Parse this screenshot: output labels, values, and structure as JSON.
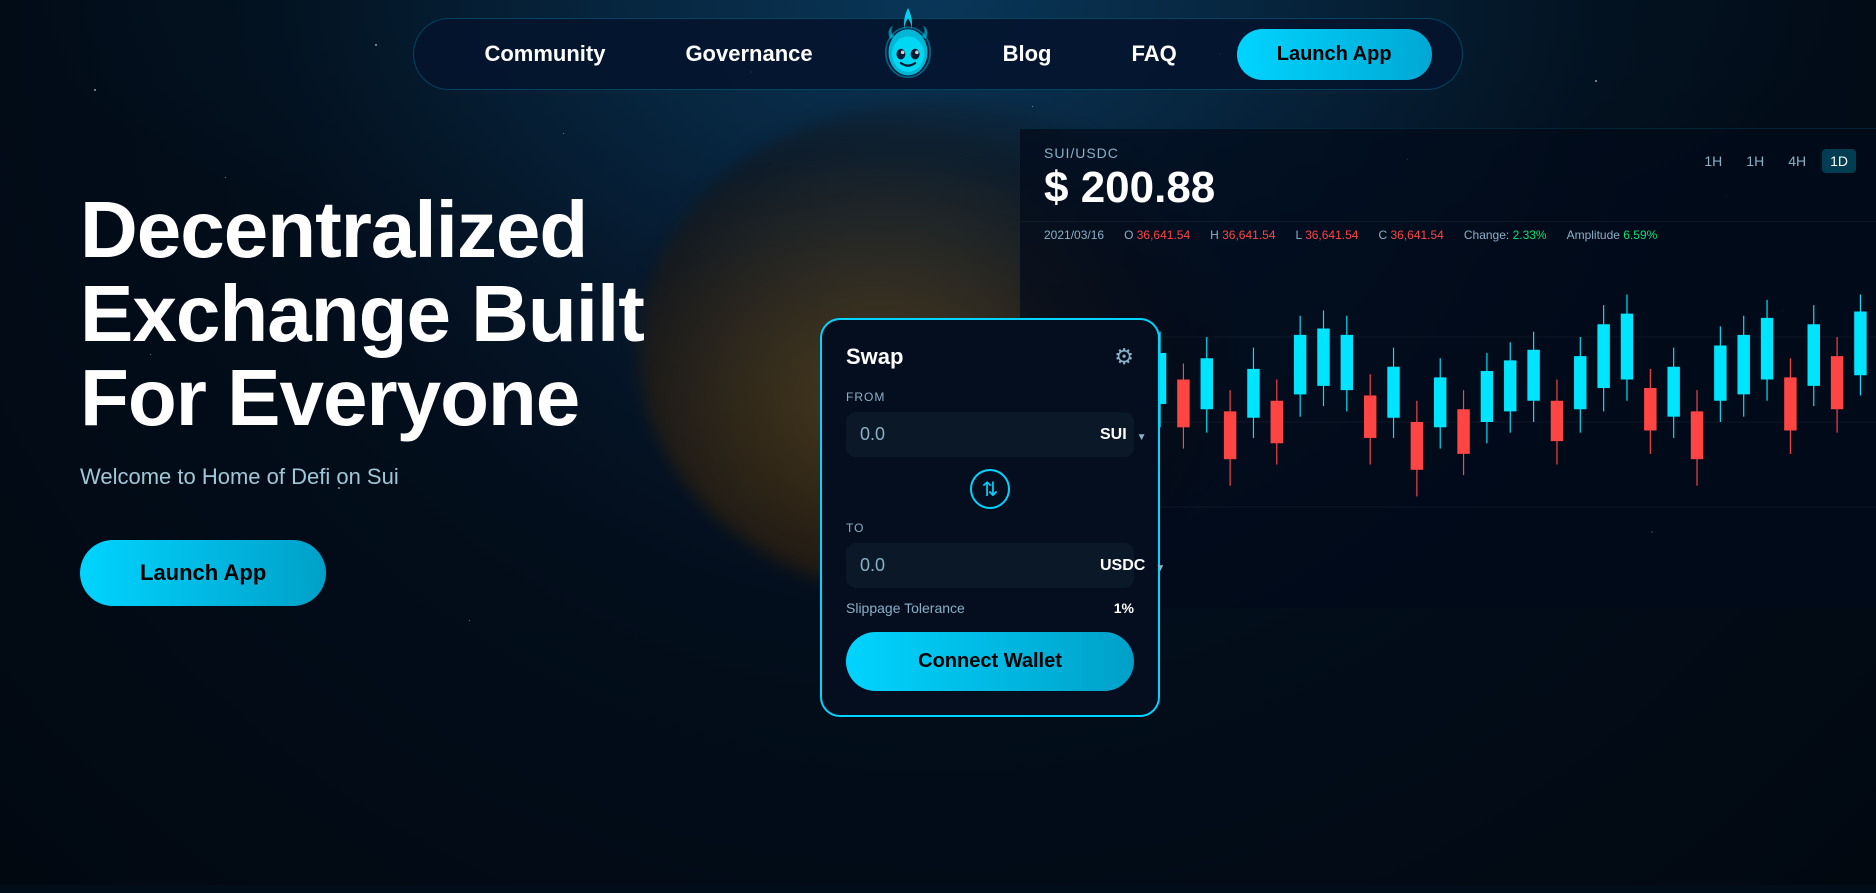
{
  "nav": {
    "community_label": "Community",
    "governance_label": "Governance",
    "blog_label": "Blog",
    "faq_label": "FAQ",
    "launch_app_label": "Launch App"
  },
  "hero": {
    "title": "Decentralized Exchange Built For Everyone",
    "subtitle": "Welcome to Home of Defi on Sui",
    "launch_app_label": "Launch App"
  },
  "chart": {
    "pair": "SUI/USDC",
    "price": "$ 200.88",
    "time_buttons": [
      "1H",
      "1H",
      "4H",
      "1D"
    ],
    "active_time": "1D",
    "date": "2021/03/16",
    "open": "36,641.54",
    "high": "36,641.54",
    "low": "36,641.54",
    "close": "36,641.54",
    "change": "2.33%",
    "amplitude": "6.59%"
  },
  "swap": {
    "title": "Swap",
    "from_label": "FROM",
    "from_value": "0.0",
    "from_token": "SUI",
    "to_label": "TO",
    "to_value": "0.0",
    "to_token": "USDC",
    "slippage_label": "Slippage Tolerance",
    "slippage_value": "1%",
    "connect_wallet_label": "Connect Wallet"
  },
  "colors": {
    "accent": "#00d4ff",
    "bg_dark": "#020d1a",
    "card_bg": "#050e1e"
  }
}
